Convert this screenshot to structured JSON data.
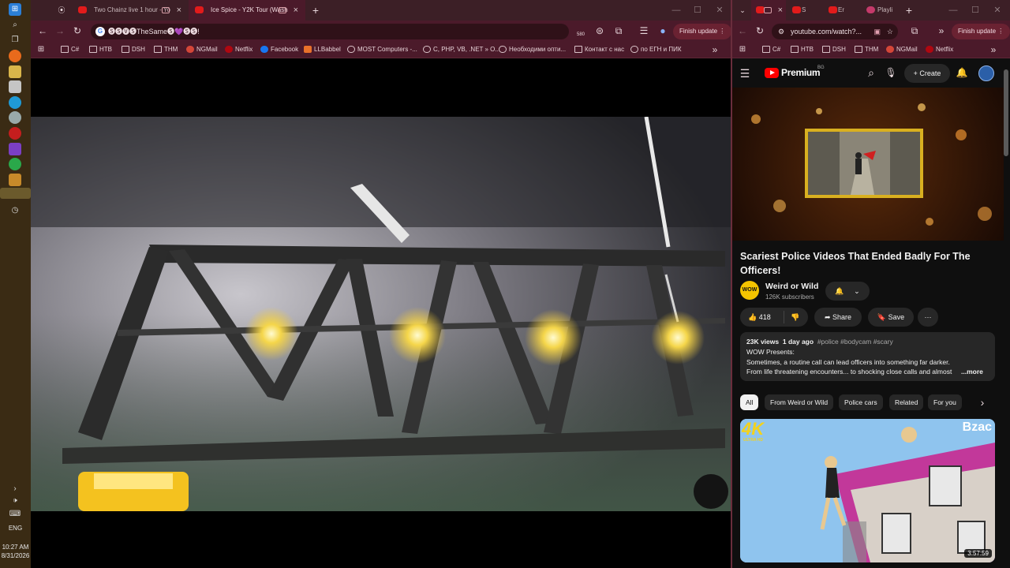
{
  "taskbar": {
    "time": "10:27 AM",
    "date": "8/31/2026",
    "language": "ENG"
  },
  "left_browser": {
    "tabs": [
      {
        "title": "Two Chainz live 1 hour - Yo"
      },
      {
        "title": "Ice Spice - Y2K Tour (Wash"
      }
    ],
    "address": "🅢🅢🅥🅢TheSame🅢💜🅢🅢!",
    "extension_badge": "580",
    "finish_update": "Finish update",
    "bookmarks": [
      "C#",
      "НТВ",
      "DSH",
      "THM",
      "NGMail",
      "Netflix",
      "Facebook",
      "LLBabbel",
      "MOST Computers -...",
      "C, PHP, VB, .NET » O...",
      "Необходими опти...",
      "Контакт с нас",
      "по ЕГН и ПИК"
    ]
  },
  "right_browser": {
    "tabs": [
      {
        "title": "S"
      },
      {
        "title": "Er"
      },
      {
        "title": "Playli"
      }
    ],
    "address": "youtube.com/watch?...",
    "finish_update": "Finish update",
    "bookmarks": [
      "C#",
      "НТВ",
      "DSH",
      "THM",
      "NGMail",
      "Netflix"
    ]
  },
  "youtube": {
    "logo": "Premium",
    "region": "BG",
    "create_label": "Create",
    "video_title": "Scariest Police Videos That Ended Badly For The Officers!",
    "channel_name": "Weird or Wild",
    "channel_avatar_text": "WOW",
    "subscribers": "126K subscribers",
    "likes": "418",
    "share_label": "Share",
    "save_label": "Save",
    "views": "23K views",
    "age": "1 day ago",
    "hashtags": "#police #bodycam #scary",
    "desc_line1": "WOW Presents:",
    "desc_line2": "Sometimes, a routine call can lead officers into something far darker.",
    "desc_line3": "From life threatening encounters... to shocking close calls and almost",
    "more_label": "...more",
    "chips": [
      "All",
      "From Weird or Wild",
      "Police cars",
      "Related",
      "For you"
    ],
    "rec_badge_left": "4K",
    "rec_badge_sub": "ULTRA HD",
    "rec_badge_right": "Bzac",
    "rec_duration": "3:57:59"
  }
}
